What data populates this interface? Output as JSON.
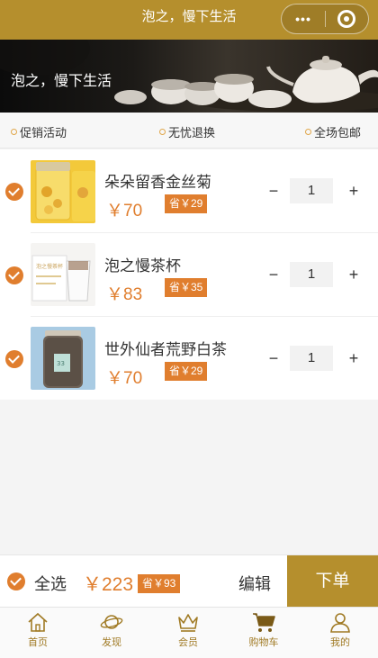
{
  "nav": {
    "title": "泡之，慢下生活",
    "menu_icon": "more-dots-icon",
    "close_icon": "target-circle-icon"
  },
  "banner": {
    "text": "泡之，慢下生活"
  },
  "features": [
    "促销活动",
    "无忧退换",
    "全场包邮"
  ],
  "cart": {
    "items": [
      {
        "name": "朵朵留香金丝菊",
        "price": "￥70",
        "save": "省￥29",
        "qty": "1",
        "minus": "−",
        "plus": "+",
        "thumb": "yellow-chrysanthemum-jar"
      },
      {
        "name": "泡之慢茶杯",
        "price": "￥83",
        "save": "省￥35",
        "qty": "1",
        "minus": "−",
        "plus": "+",
        "thumb": "tea-cup-box"
      },
      {
        "name": "世外仙者荒野白茶",
        "price": "￥70",
        "save": "省￥29",
        "qty": "1",
        "minus": "−",
        "plus": "+",
        "thumb": "white-tea-jar"
      }
    ]
  },
  "footer": {
    "select_all": "全选",
    "total": "￥223",
    "save": "省￥93",
    "edit": "编辑",
    "order": "下单"
  },
  "tabs": [
    {
      "label": "首页",
      "icon": "home-icon"
    },
    {
      "label": "发现",
      "icon": "planet-icon"
    },
    {
      "label": "会员",
      "icon": "crown-icon"
    },
    {
      "label": "购物车",
      "icon": "cart-icon"
    },
    {
      "label": "我的",
      "icon": "user-icon"
    }
  ],
  "colors": {
    "brand": "#b58f2d",
    "accent": "#e07e2e"
  }
}
